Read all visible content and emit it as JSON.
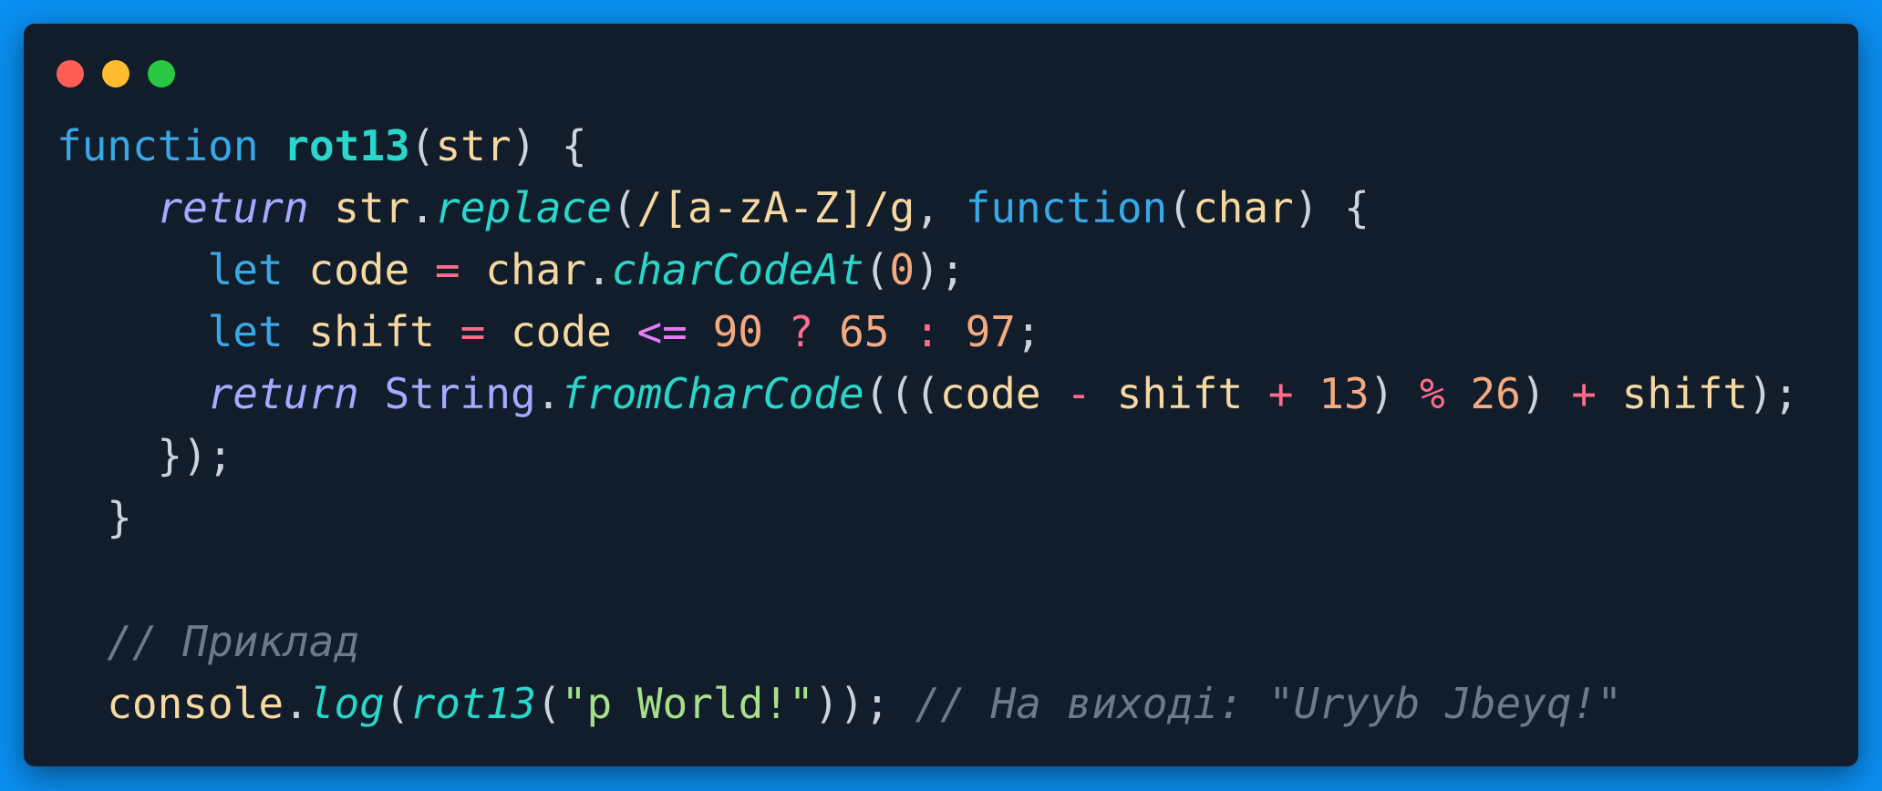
{
  "window": {
    "controls": [
      "close",
      "minimize",
      "zoom"
    ],
    "colors": {
      "background": "#0a8ef0",
      "panel": "#121d2b",
      "close": "#ff5f57",
      "minimize": "#febc2e",
      "zoom": "#28c840"
    }
  },
  "code": {
    "language": "javascript",
    "lines": [
      {
        "indent": 0,
        "tokens": [
          {
            "t": "function",
            "c": "kw"
          },
          {
            "t": " ",
            "c": "punc"
          },
          {
            "t": "rot13",
            "c": "fn"
          },
          {
            "t": "(",
            "c": "punc"
          },
          {
            "t": "str",
            "c": "var"
          },
          {
            "t": ") {",
            "c": "punc"
          }
        ]
      },
      {
        "indent": 4,
        "tokens": [
          {
            "t": "return",
            "c": "ret"
          },
          {
            "t": " ",
            "c": "punc"
          },
          {
            "t": "str",
            "c": "var"
          },
          {
            "t": ".",
            "c": "punc"
          },
          {
            "t": "replace",
            "c": "fn-i"
          },
          {
            "t": "(",
            "c": "punc"
          },
          {
            "t": "/[a-zA-Z]/g",
            "c": "regex"
          },
          {
            "t": ", ",
            "c": "punc"
          },
          {
            "t": "function",
            "c": "kw"
          },
          {
            "t": "(",
            "c": "punc"
          },
          {
            "t": "char",
            "c": "var"
          },
          {
            "t": ") {",
            "c": "punc"
          }
        ]
      },
      {
        "indent": 6,
        "tokens": [
          {
            "t": "let",
            "c": "kw"
          },
          {
            "t": " ",
            "c": "punc"
          },
          {
            "t": "code",
            "c": "var"
          },
          {
            "t": " ",
            "c": "punc"
          },
          {
            "t": "=",
            "c": "op"
          },
          {
            "t": " ",
            "c": "punc"
          },
          {
            "t": "char",
            "c": "var"
          },
          {
            "t": ".",
            "c": "punc"
          },
          {
            "t": "charCodeAt",
            "c": "fn-i"
          },
          {
            "t": "(",
            "c": "punc"
          },
          {
            "t": "0",
            "c": "num"
          },
          {
            "t": ");",
            "c": "punc"
          }
        ]
      },
      {
        "indent": 6,
        "tokens": [
          {
            "t": "let",
            "c": "kw"
          },
          {
            "t": " ",
            "c": "punc"
          },
          {
            "t": "shift",
            "c": "var"
          },
          {
            "t": " ",
            "c": "punc"
          },
          {
            "t": "=",
            "c": "op"
          },
          {
            "t": " ",
            "c": "punc"
          },
          {
            "t": "code",
            "c": "var"
          },
          {
            "t": " ",
            "c": "punc"
          },
          {
            "t": "<=",
            "c": "cmp"
          },
          {
            "t": " ",
            "c": "punc"
          },
          {
            "t": "90",
            "c": "num"
          },
          {
            "t": " ",
            "c": "punc"
          },
          {
            "t": "?",
            "c": "op"
          },
          {
            "t": " ",
            "c": "punc"
          },
          {
            "t": "65",
            "c": "num"
          },
          {
            "t": " ",
            "c": "punc"
          },
          {
            "t": ":",
            "c": "op"
          },
          {
            "t": " ",
            "c": "punc"
          },
          {
            "t": "97",
            "c": "num"
          },
          {
            "t": ";",
            "c": "punc"
          }
        ]
      },
      {
        "indent": 6,
        "tokens": [
          {
            "t": "return",
            "c": "ret"
          },
          {
            "t": " ",
            "c": "punc"
          },
          {
            "t": "String",
            "c": "cls"
          },
          {
            "t": ".",
            "c": "punc"
          },
          {
            "t": "fromCharCode",
            "c": "fn-i"
          },
          {
            "t": "(((",
            "c": "punc"
          },
          {
            "t": "code",
            "c": "var"
          },
          {
            "t": " ",
            "c": "punc"
          },
          {
            "t": "-",
            "c": "op"
          },
          {
            "t": " ",
            "c": "punc"
          },
          {
            "t": "shift",
            "c": "var"
          },
          {
            "t": " ",
            "c": "punc"
          },
          {
            "t": "+",
            "c": "op"
          },
          {
            "t": " ",
            "c": "punc"
          },
          {
            "t": "13",
            "c": "num"
          },
          {
            "t": ") ",
            "c": "punc"
          },
          {
            "t": "%",
            "c": "op"
          },
          {
            "t": " ",
            "c": "punc"
          },
          {
            "t": "26",
            "c": "num"
          },
          {
            "t": ") ",
            "c": "punc"
          },
          {
            "t": "+",
            "c": "op"
          },
          {
            "t": " ",
            "c": "punc"
          },
          {
            "t": "shift",
            "c": "var"
          },
          {
            "t": ");",
            "c": "punc"
          }
        ]
      },
      {
        "indent": 4,
        "tokens": [
          {
            "t": "});",
            "c": "punc"
          }
        ]
      },
      {
        "indent": 2,
        "tokens": [
          {
            "t": "}",
            "c": "punc"
          }
        ]
      },
      {
        "indent": 0,
        "tokens": []
      },
      {
        "indent": 2,
        "tokens": [
          {
            "t": "// Приклад",
            "c": "cmt"
          }
        ]
      },
      {
        "indent": 2,
        "tokens": [
          {
            "t": "console",
            "c": "var"
          },
          {
            "t": ".",
            "c": "punc"
          },
          {
            "t": "log",
            "c": "fn-i"
          },
          {
            "t": "(",
            "c": "punc"
          },
          {
            "t": "rot13",
            "c": "fn-i"
          },
          {
            "t": "(",
            "c": "punc"
          },
          {
            "t": "\"p World!\"",
            "c": "str"
          },
          {
            "t": ")); ",
            "c": "punc"
          },
          {
            "t": "// На виході: \"Uryyb Jbeyq!\"",
            "c": "cmt"
          }
        ]
      }
    ]
  }
}
